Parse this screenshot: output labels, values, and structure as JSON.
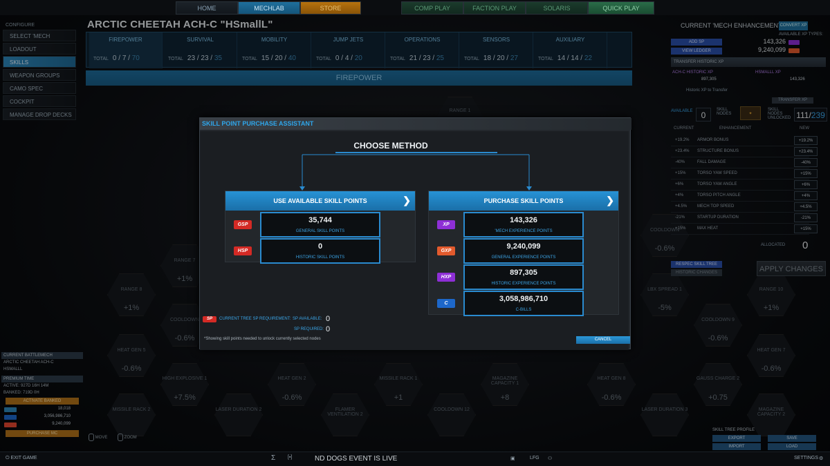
{
  "nav": {
    "home": "HOME",
    "mechlab": "MECHLAB",
    "store": "STORE",
    "comp_play": "COMP PLAY",
    "faction_play": "FACTION PLAY",
    "solaris": "SOLARIS",
    "quick_play": "QUICK PLAY"
  },
  "menu": {
    "header": "CONFIGURE",
    "items": [
      "SELECT 'MECH",
      "LOADOUT",
      "SKILLS",
      "WEAPON GROUPS",
      "CAMO SPEC",
      "COCKPIT",
      "MANAGE DROP DECKS"
    ],
    "active_index": 2
  },
  "mech_title": "ARCTIC CHEETAH ACH-C \"HSmallL\"",
  "tabs": [
    {
      "name": "FIREPOWER",
      "total_label": "TOTAL",
      "current": "0",
      "unlocked": "7",
      "max": "70"
    },
    {
      "name": "SURVIVAL",
      "total_label": "TOTAL",
      "current": "23",
      "unlocked": "23",
      "max": "35"
    },
    {
      "name": "MOBILITY",
      "total_label": "TOTAL",
      "current": "15",
      "unlocked": "20",
      "max": "40"
    },
    {
      "name": "JUMP JETS",
      "total_label": "TOTAL",
      "current": "0",
      "unlocked": "4",
      "max": "20"
    },
    {
      "name": "OPERATIONS",
      "total_label": "TOTAL",
      "current": "21",
      "unlocked": "23",
      "max": "25"
    },
    {
      "name": "SENSORS",
      "total_label": "TOTAL",
      "current": "18",
      "unlocked": "20",
      "max": "27"
    },
    {
      "name": "AUXILIARY",
      "total_label": "TOTAL",
      "current": "14",
      "unlocked": "14",
      "max": "22"
    }
  ],
  "section_title": "FIREPOWER",
  "hexes": [
    {
      "label": "RANGE 1",
      "value": ""
    },
    {
      "label": "RANGE 7",
      "value": "+1%"
    },
    {
      "label": "RANGE 8",
      "value": "+1%"
    },
    {
      "label": "COOLDOWN",
      "value": "-0.6%"
    },
    {
      "label": "HEAT GEN 5",
      "value": "-0.6%"
    },
    {
      "label": "HIGH EXPLOSIVE 1",
      "value": "+7.5%"
    },
    {
      "label": "MISSILE RACK 2",
      "value": ""
    },
    {
      "label": "LASER DURATION 2",
      "value": ""
    },
    {
      "label": "HEAT GEN 2",
      "value": "-0.6%"
    },
    {
      "label": "FLAMER VENTILATION 2",
      "value": ""
    },
    {
      "label": "MISSILE RACK 1",
      "value": "+1"
    },
    {
      "label": "COOLDOWN 12",
      "value": ""
    },
    {
      "label": "MAGAZINE CAPACITY 1",
      "value": "+8"
    },
    {
      "label": "HEAT GEN 8",
      "value": "-0.6%"
    },
    {
      "label": "GAUSS CHARGE 2",
      "value": "+0.75"
    },
    {
      "label": "LASER DURATION 3",
      "value": ""
    },
    {
      "label": "MAGAZINE CAPACITY 2",
      "value": ""
    },
    {
      "label": "LBX SPREAD 1",
      "value": "-5%"
    },
    {
      "label": "COOLDOWN 9",
      "value": "-0.6%"
    },
    {
      "label": "RANGE 10",
      "value": "+1%"
    },
    {
      "label": "HEAT GEN 7",
      "value": "-0.6%"
    },
    {
      "label": "COOLDOWN",
      "value": "-0.6%"
    }
  ],
  "right_panel": {
    "title": "CURRENT 'MECH ENHANCEMENTS",
    "convert_xp": "CONVERT XP",
    "available_xp_types": "AVAILABLE XP TYPES:",
    "add_sp": "ADD SP",
    "view_ledger": "VIEW LEDGER",
    "xp_values": [
      "143,326",
      "9,240,099"
    ],
    "transfer_bar": "TRANSFER HISTORIC XP",
    "historic_label": "ACH-C HISTORIC XP",
    "historic_value": "897,305",
    "hsmall_label": "HSMALLL XP",
    "hsmall_value": "143,326",
    "historic_to_transfer": "Historic XP to Transfer",
    "transfer_btn": "TRANSFER XP",
    "available_label": "AVAILABLE",
    "available_value": "0",
    "skill_nodes_label": "SKILL NODES",
    "unlocked_label": "SKILL NODES UNLOCKED",
    "unlocked_value": "111",
    "unlocked_max": "239",
    "col_current": "CURRENT",
    "col_enhancement": "ENHANCEMENT",
    "col_new": "NEW",
    "enhancements": [
      {
        "current": "+19.2%",
        "name": "ARMOR BONUS",
        "new": "+19.2%"
      },
      {
        "current": "+23.4%",
        "name": "STRUCTURE BONUS",
        "new": "+23.4%"
      },
      {
        "current": "-40%",
        "name": "FALL DAMAGE",
        "new": "-40%"
      },
      {
        "current": "+15%",
        "name": "TORSO YAW SPEED",
        "new": "+15%"
      },
      {
        "current": "+6%",
        "name": "TORSO YAW ANGLE",
        "new": "+6%"
      },
      {
        "current": "+4%",
        "name": "TORSO PITCH ANGLE",
        "new": "+4%"
      },
      {
        "current": "+4.5%",
        "name": "MECH TOP SPEED",
        "new": "+4.5%"
      },
      {
        "current": "-21%",
        "name": "STARTUP DURATION",
        "new": "-21%"
      },
      {
        "current": "+15%",
        "name": "MAX HEAT",
        "new": "+15%"
      }
    ],
    "allocated_label": "ALLOCATED",
    "allocated_value": "0",
    "respec": "RESPEC SKILL TREE",
    "historic_changes": "HISTORIC CHANGES",
    "apply": "APPLY CHANGES"
  },
  "left_bottom": {
    "current_battlemech": "CURRENT BATTLEMECH",
    "mech_name": "ARCTIC CHEETAH ACH-C",
    "mech_nick": "HSMALLL",
    "premium_time": "PREMIUM TIME",
    "active_label": "ACTIVE:",
    "active_value": "927D  16H  14M",
    "banked_label": "BANKED:",
    "banked_value": "719D  0H",
    "activate_banked": "ACTIVATE BANKED",
    "currencies": [
      {
        "value": "18,018",
        "color": "#2d86b9"
      },
      {
        "value": "3,056,986,710",
        "color": "#1d67c9"
      },
      {
        "value": "9,240,099",
        "color": "#e2462e"
      }
    ],
    "purchase_mc": "PURCHASE MC"
  },
  "controls": {
    "move": "MOVE",
    "zoom": "ZOOM"
  },
  "profile": {
    "title": "SKILL TREE PROFILE",
    "export": "EXPORT",
    "save": "SAVE",
    "import": "IMPORT",
    "load": "LOAD"
  },
  "bottom": {
    "exit": "EXIT GAME",
    "event": "ND DOGS EVENT IS LIVE",
    "lfg": "LFG",
    "settings": "SETTINGS"
  },
  "modal": {
    "title": "SKILL POINT PURCHASE ASSISTANT",
    "choose": "CHOOSE METHOD",
    "left": {
      "header": "USE AVAILABLE SKILL POINTS",
      "rows": [
        {
          "icon": "GSP",
          "value": "35,744",
          "label": "GENERAL SKILL POINTS",
          "color": "#d42a25"
        },
        {
          "icon": "HSP",
          "value": "0",
          "label": "HISTORIC SKILL POINTS",
          "color": "#d42a25"
        }
      ]
    },
    "right": {
      "header": "PURCHASE SKILL POINTS",
      "rows": [
        {
          "icon": "XP",
          "value": "143,326",
          "label": "'MECH EXPERIENCE POINTS",
          "color": "#8e2fd6"
        },
        {
          "icon": "GXP",
          "value": "9,240,099",
          "label": "GENERAL EXPERIENCE POINTS",
          "color": "#e25a2d"
        },
        {
          "icon": "HXP",
          "value": "897,305",
          "label": "HISTORIC EXPERIENCE POINTS",
          "color": "#8e2fd6"
        },
        {
          "icon": "C",
          "value": "3,058,986,710",
          "label": "C-BILLS",
          "color": "#1d67c9"
        }
      ]
    },
    "req_label": "CURRENT TREE SP REQUIREMENT:",
    "sp_available_label": "SP AVAILABLE:",
    "sp_available": "0",
    "sp_required_label": "SP REQUIRED:",
    "sp_required": "0",
    "note": "*Showing skill points needed to unlock currently selected nodes",
    "cancel": "CANCEL"
  }
}
